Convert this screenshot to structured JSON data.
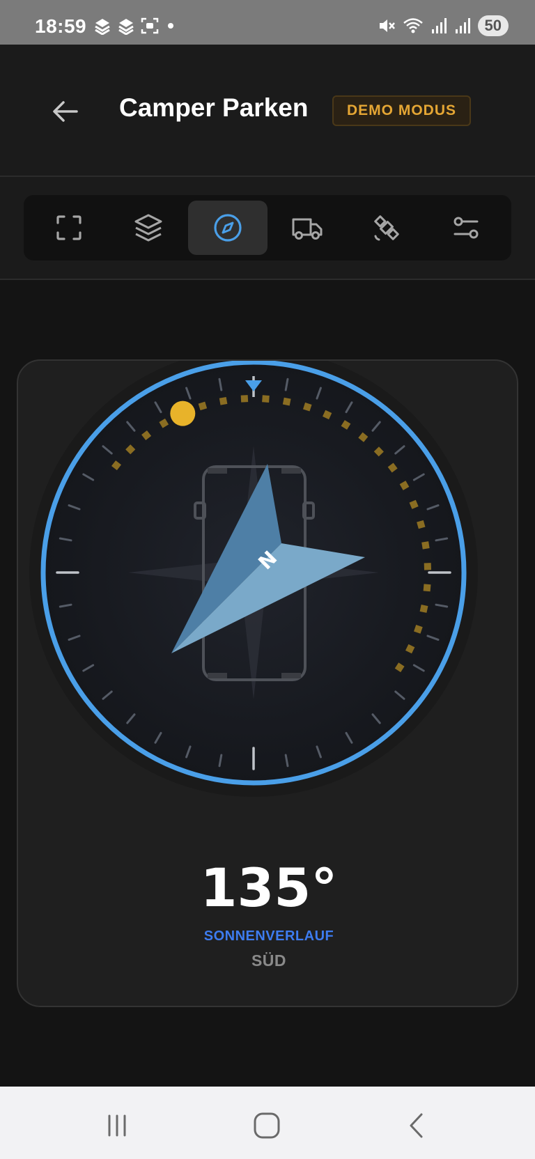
{
  "status_bar": {
    "time": "18:59",
    "battery": "50",
    "icons_left": [
      "layers-icon",
      "layers-icon",
      "screenshot-icon",
      "dot-icon"
    ],
    "icons_right": [
      "mute-icon",
      "wifi-icon",
      "signal-icon",
      "signal-icon"
    ]
  },
  "header": {
    "title": "Camper Parken",
    "badge": "DEMO MODUS"
  },
  "toolbar": {
    "items": [
      {
        "name": "frame-icon",
        "active": false
      },
      {
        "name": "layers-icon",
        "active": false
      },
      {
        "name": "compass-icon",
        "active": true
      },
      {
        "name": "truck-icon",
        "active": false
      },
      {
        "name": "satellite-icon",
        "active": false
      },
      {
        "name": "sliders-icon",
        "active": false
      }
    ]
  },
  "compass": {
    "heading": "135°",
    "sun_label": "SONNENVERLAUF",
    "direction": "SÜD",
    "north_letter": "N",
    "heading_degrees": 135,
    "sun_position_degrees": -24,
    "colors": {
      "ring": "#4a9fe8",
      "sun": "#e8b32a",
      "needle_dark": "#4e7fa6",
      "needle_light": "#7aa9c9",
      "accent_blue": "#3d7cf0",
      "badge_text": "#e5a634"
    }
  },
  "nav_bar": {
    "items": [
      "recent-apps-icon",
      "home-icon",
      "back-icon"
    ]
  }
}
